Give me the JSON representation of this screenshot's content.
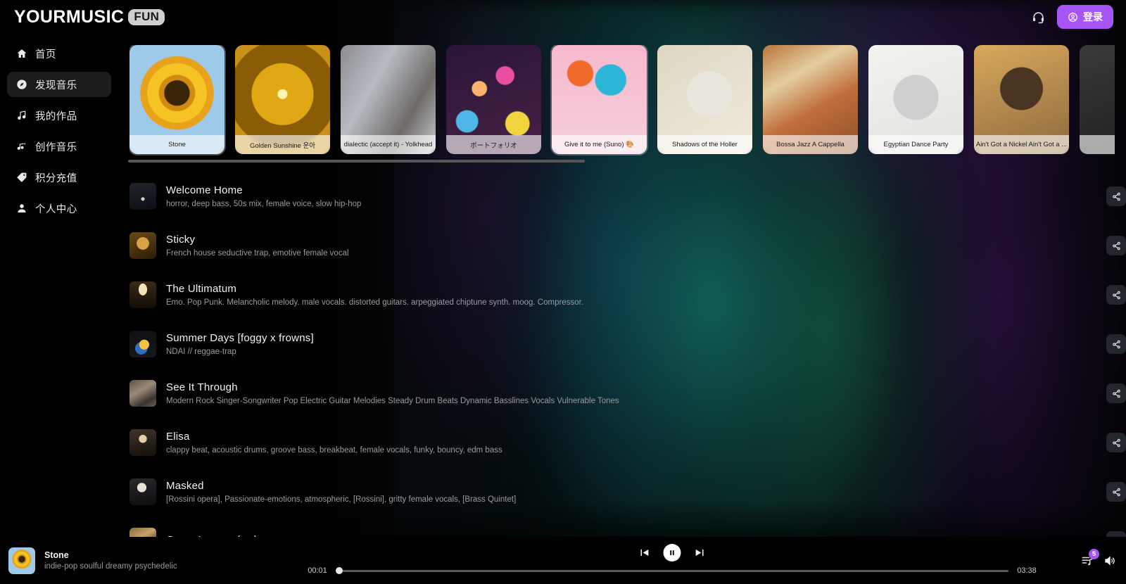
{
  "header": {
    "logo_main": "YOURMUSIC",
    "logo_badge": "FUN",
    "support_icon": "headset-icon",
    "login_label": "登录",
    "login_icon": "user-circle-icon",
    "accent_color": "#a855f7"
  },
  "sidebar": {
    "items": [
      {
        "label": "首页",
        "icon": "home-icon",
        "active": false
      },
      {
        "label": "发现音乐",
        "icon": "compass-icon",
        "active": true
      },
      {
        "label": "我的作品",
        "icon": "music-note-icon",
        "active": false
      },
      {
        "label": "创作音乐",
        "icon": "music-sparkle-icon",
        "active": false
      },
      {
        "label": "积分充值",
        "icon": "tag-icon",
        "active": false
      },
      {
        "label": "个人中心",
        "icon": "user-icon",
        "active": false
      }
    ]
  },
  "carousel": {
    "cards": [
      {
        "title": "Stone",
        "art": "art-sunflower",
        "highlight": true
      },
      {
        "title": "Golden Sunshine 운아",
        "art": "art-heart",
        "highlight": false
      },
      {
        "title": "dialectic (accept it) - Yolkhead",
        "art": "art-frost",
        "highlight": false
      },
      {
        "title": "ポートフォリオ",
        "art": "art-bokeh",
        "highlight": false
      },
      {
        "title": "Give it to me (Suno) 🎨",
        "art": "art-doll",
        "highlight": true
      },
      {
        "title": "Shadows of the Holler",
        "art": "art-bird",
        "highlight": false
      },
      {
        "title": "Bossa Jazz A Cappella",
        "art": "art-dance",
        "highlight": false
      },
      {
        "title": "Egyptian Dance Party",
        "art": "art-sketch",
        "highlight": false
      },
      {
        "title": "Ain't Got a Nickel Ain't Got a ...",
        "art": "art-portrait",
        "highlight": false
      },
      {
        "title": "",
        "art": "art-grey",
        "highlight": false
      }
    ],
    "scrollbar": {
      "thumb_percent": 46
    }
  },
  "tracks": [
    {
      "title": "Welcome Home",
      "subtitle": "horror, deep bass, 50s mix, female voice, slow hip-hop",
      "art": "art-house",
      "share_icon": "share-icon"
    },
    {
      "title": "Sticky",
      "subtitle": "French house seductive trap, emotive female vocal",
      "art": "art-sticky",
      "share_icon": "share-icon"
    },
    {
      "title": "The Ultimatum",
      "subtitle": "Emo. Pop Punk. Melancholic melody. male vocals. distorted guitars. arpeggiated chiptune synth. moog. Compressor.",
      "art": "art-ultimatum",
      "share_icon": "share-icon"
    },
    {
      "title": "Summer Days [foggy x frowns]",
      "subtitle": "NDAI // reggae-trap",
      "art": "art-summer",
      "share_icon": "share-icon"
    },
    {
      "title": "See It Through",
      "subtitle": "Modern Rock Singer-Songwriter Pop Electric Guitar Melodies Steady Drum Beats Dynamic Basslines Vocals Vulnerable Tones",
      "art": "art-seeit",
      "share_icon": "share-icon"
    },
    {
      "title": "Elisa",
      "subtitle": "clappy beat, acoustic drums, groove bass, breakbeat, female vocals, funky, bouncy, edm bass",
      "art": "art-elisa",
      "share_icon": "share-icon"
    },
    {
      "title": "Masked",
      "subtitle": "[Rossini opera], Passionate-emotions, atmospheric, [Rossini], gritty female vocals, [Brass Quintet]",
      "art": "art-masked",
      "share_icon": "share-icon"
    },
    {
      "title": "Gross Income (ew)",
      "subtitle": "",
      "art": "art-gross",
      "share_icon": "share-icon"
    }
  ],
  "player": {
    "now_playing_title": "Stone",
    "now_playing_subtitle": "indie-pop soulful dreamy psychedelic",
    "art": "art-sunflower",
    "prev_icon": "skip-previous-icon",
    "play_state_icon": "pause-icon",
    "next_icon": "skip-next-icon",
    "current_time": "00:01",
    "total_time": "03:38",
    "progress_percent": 0.5,
    "queue_icon": "playlist-queue-icon",
    "queue_count": "5",
    "volume_icon": "volume-icon"
  }
}
